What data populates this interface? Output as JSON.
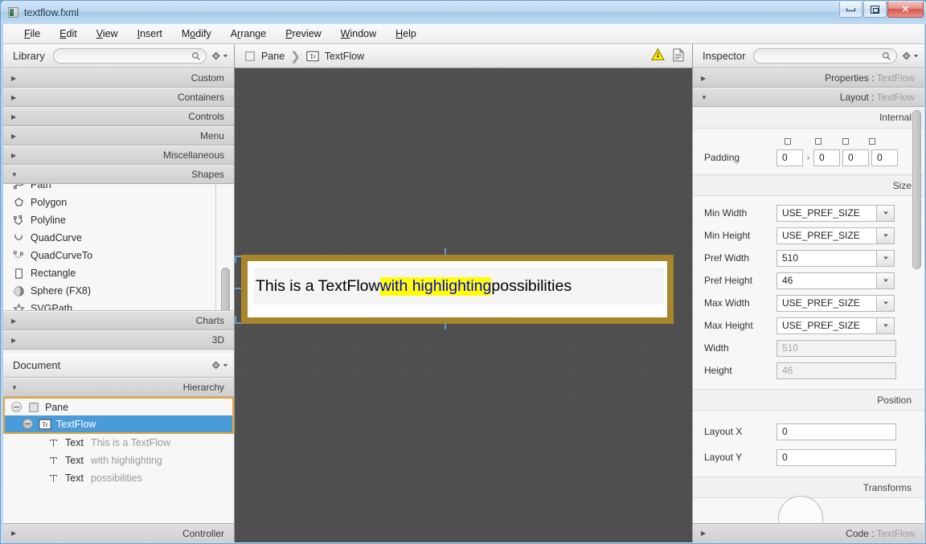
{
  "window": {
    "title": "textflow.fxml",
    "controls": {
      "minimize": "Minimize",
      "maximize": "Maximize",
      "close": "✕"
    }
  },
  "menubar": {
    "items": [
      {
        "label": "File",
        "mnemonic": "F"
      },
      {
        "label": "Edit",
        "mnemonic": "E"
      },
      {
        "label": "View",
        "mnemonic": "V"
      },
      {
        "label": "Insert",
        "mnemonic": "I"
      },
      {
        "label": "Modify",
        "mnemonic": "o"
      },
      {
        "label": "Arrange",
        "mnemonic": "r"
      },
      {
        "label": "Preview",
        "mnemonic": "P"
      },
      {
        "label": "Window",
        "mnemonic": "W"
      },
      {
        "label": "Help",
        "mnemonic": "H"
      }
    ]
  },
  "library": {
    "title": "Library",
    "search_placeholder": "",
    "search_value": "",
    "search_icon": "search-icon",
    "gear_icon": "gear-icon",
    "sections": [
      {
        "label": "Custom",
        "expanded": false
      },
      {
        "label": "Containers",
        "expanded": false
      },
      {
        "label": "Controls",
        "expanded": false
      },
      {
        "label": "Menu",
        "expanded": false
      },
      {
        "label": "Miscellaneous",
        "expanded": false
      },
      {
        "label": "Shapes",
        "expanded": true
      }
    ],
    "shape_items": [
      {
        "label": "Path",
        "icon": "path-icon"
      },
      {
        "label": "Polygon",
        "icon": "polygon-icon"
      },
      {
        "label": "Polyline",
        "icon": "polyline-icon"
      },
      {
        "label": "QuadCurve",
        "icon": "quadcurve-icon"
      },
      {
        "label": "QuadCurveTo",
        "icon": "quadcurveto-icon"
      },
      {
        "label": "Rectangle",
        "icon": "rectangle-icon"
      },
      {
        "label": "Sphere  (FX8)",
        "icon": "sphere-icon"
      },
      {
        "label": "SVGPath",
        "icon": "svgpath-icon"
      }
    ],
    "sections_after": [
      {
        "label": "Charts",
        "expanded": false
      },
      {
        "label": "3D",
        "expanded": false
      }
    ]
  },
  "document": {
    "title": "Document",
    "gear_icon": "gear-icon",
    "hierarchy_label": "Hierarchy",
    "controller_label": "Controller",
    "tree": [
      {
        "name": "Pane",
        "value": "",
        "icon": "pane-icon",
        "depth": 0,
        "selected": false,
        "outlined": true,
        "expander": "collapse"
      },
      {
        "name": "TextFlow",
        "value": "",
        "icon": "textflow-icon",
        "depth": 1,
        "selected": true,
        "outlined": true,
        "expander": "collapse"
      },
      {
        "name": "Text",
        "value": "This is a TextFlow",
        "icon": "text-icon",
        "depth": 2,
        "selected": false,
        "outlined": false,
        "expander": "none"
      },
      {
        "name": "Text",
        "value": "with highlighting",
        "icon": "text-icon",
        "depth": 2,
        "selected": false,
        "outlined": false,
        "expander": "none"
      },
      {
        "name": "Text",
        "value": "possibilities",
        "icon": "text-icon",
        "depth": 2,
        "selected": false,
        "outlined": false,
        "expander": "none"
      }
    ]
  },
  "breadcrumb": {
    "items": [
      {
        "label": "Pane",
        "icon": "pane-icon"
      },
      {
        "label": "TextFlow",
        "icon": "textflow-icon"
      }
    ],
    "separator": "〉",
    "warning_icon": "warning-triangle-icon",
    "preview_icon": "document-icon"
  },
  "canvas": {
    "textflow": {
      "segment_1": "This is a TextFlow ",
      "segment_highlight": "with highlighting",
      "segment_3": " possibilities",
      "highlight_color": "#ffff00",
      "highlight_text_color": "#0000ee",
      "selection_border_color": "#a8842c",
      "handle_color": "#5b9bd5"
    }
  },
  "inspector": {
    "title": "Inspector",
    "search_placeholder": "",
    "search_value": "",
    "search_icon": "search-icon",
    "gear_icon": "gear-icon",
    "accordions": [
      {
        "label": "Properties : TextFlow",
        "prefix": "Properties : ",
        "suffix": "TextFlow",
        "expanded": false
      },
      {
        "label": "Layout : TextFlow",
        "prefix": "Layout : ",
        "suffix": "TextFlow",
        "expanded": true
      }
    ],
    "code_accordion": {
      "prefix": "Code : ",
      "suffix": "TextFlow"
    },
    "sections": {
      "internal": "Internal",
      "size": "Size",
      "position": "Position",
      "transforms": "Transforms"
    },
    "padding": {
      "label": "Padding",
      "values": [
        "0",
        "0",
        "0",
        "0"
      ],
      "chevron": "›"
    },
    "size_rows": [
      {
        "label": "Min Width",
        "value": "USE_PREF_SIZE",
        "combo": true,
        "readonly": false
      },
      {
        "label": "Min Height",
        "value": "USE_PREF_SIZE",
        "combo": true,
        "readonly": false
      },
      {
        "label": "Pref Width",
        "value": "510",
        "combo": true,
        "readonly": false
      },
      {
        "label": "Pref Height",
        "value": "46",
        "combo": true,
        "readonly": false
      },
      {
        "label": "Max Width",
        "value": "USE_PREF_SIZE",
        "combo": true,
        "readonly": false
      },
      {
        "label": "Max Height",
        "value": "USE_PREF_SIZE",
        "combo": true,
        "readonly": false
      },
      {
        "label": "Width",
        "value": "510",
        "combo": false,
        "readonly": true
      },
      {
        "label": "Height",
        "value": "46",
        "combo": false,
        "readonly": true
      }
    ],
    "position_rows": [
      {
        "label": "Layout X",
        "value": "0",
        "combo": false,
        "readonly": false
      },
      {
        "label": "Layout Y",
        "value": "0",
        "combo": false,
        "readonly": false
      }
    ]
  }
}
